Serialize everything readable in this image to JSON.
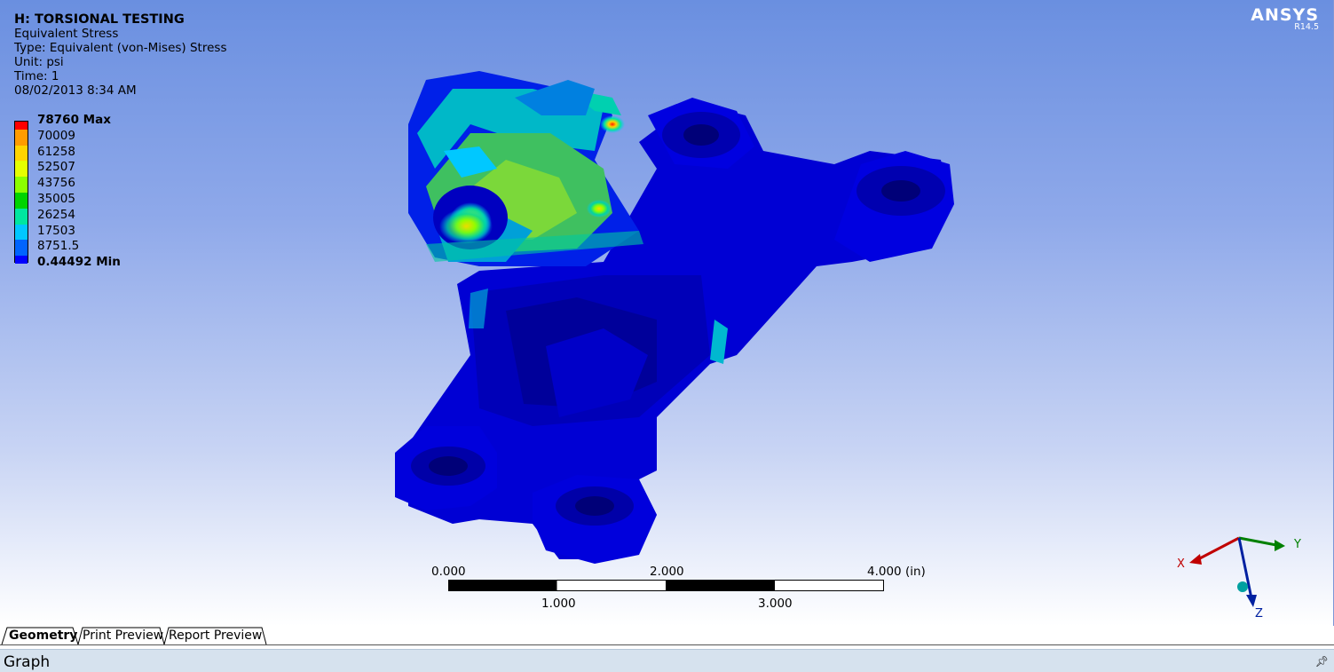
{
  "info": {
    "title": "H: TORSIONAL TESTING",
    "result": "Equivalent Stress",
    "type": "Type: Equivalent (von-Mises) Stress",
    "unit": "Unit: psi",
    "time": "Time: 1",
    "date": "08/02/2013 8:34 AM"
  },
  "legend": {
    "labels": [
      "78760 Max",
      "70009",
      "61258",
      "52507",
      "43756",
      "35005",
      "26254",
      "17503",
      "8751.5",
      "0.44492 Min"
    ],
    "colors": [
      "#ff0000",
      "#ff9c00",
      "#ffd400",
      "#e6ff00",
      "#8cff00",
      "#00d400",
      "#00e6a0",
      "#00c8ff",
      "#0064ff",
      "#0000ff"
    ]
  },
  "logo": {
    "name": "ANSYS",
    "version": "R14.5"
  },
  "scale": {
    "top_labels": [
      "0.000",
      "2.000",
      "4.000 (in)"
    ],
    "bottom_labels": [
      "1.000",
      "3.000"
    ]
  },
  "triad": {
    "x": "X",
    "y": "Y",
    "z": "Z"
  },
  "tabs": [
    "Geometry",
    "Print Preview",
    "Report Preview"
  ],
  "active_tab": "Geometry",
  "panel": {
    "title": "Graph",
    "pin_icon": "pin-icon"
  }
}
